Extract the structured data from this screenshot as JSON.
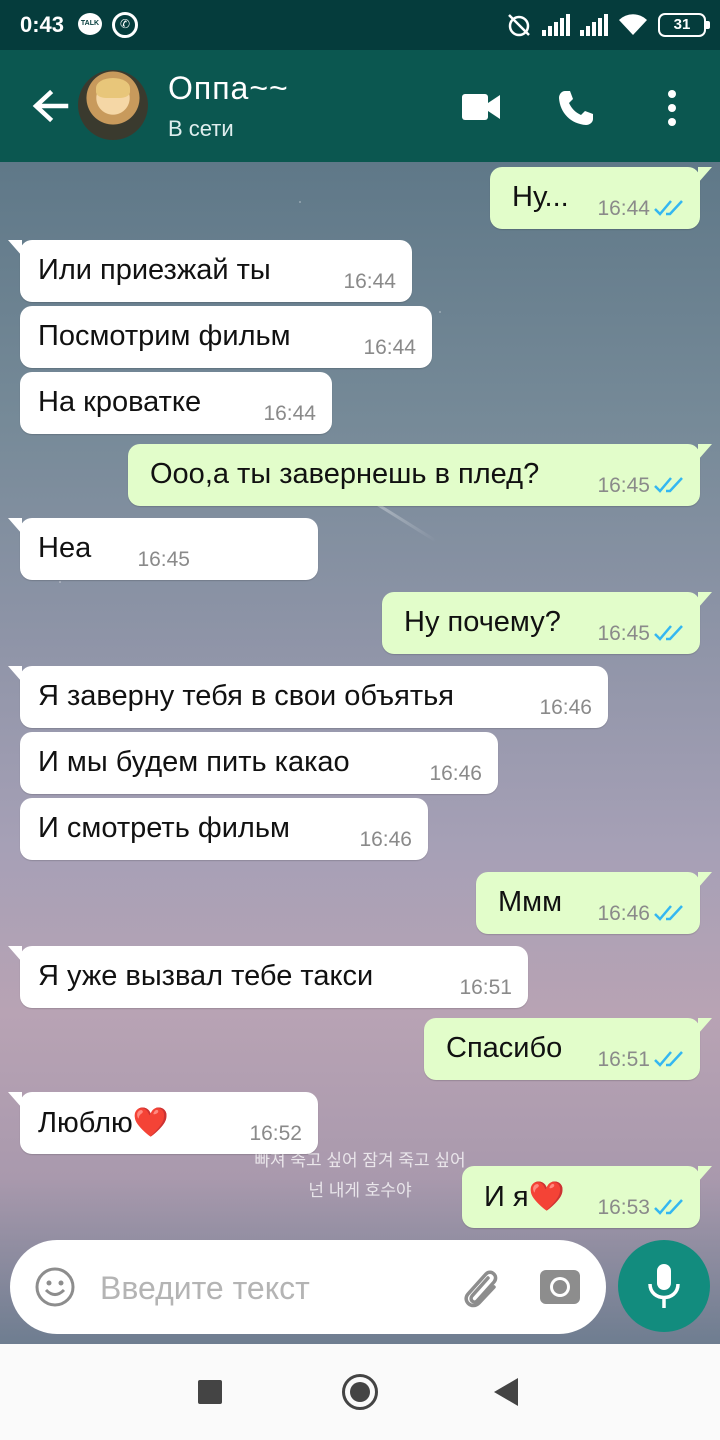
{
  "status_bar": {
    "time": "0:43",
    "talk_badge": "TALK",
    "battery": "31"
  },
  "header": {
    "contact_name": "Оппа~~",
    "contact_status": "В сети"
  },
  "messages": [
    {
      "dir": "out",
      "text": "Ну...",
      "time": "16:44"
    },
    {
      "dir": "in",
      "text": "Или приезжай ты",
      "time": "16:44"
    },
    {
      "dir": "in",
      "text": "Посмотрим фильм",
      "time": "16:44"
    },
    {
      "dir": "in",
      "text": "На кроватке",
      "time": "16:44"
    },
    {
      "dir": "out",
      "text": "Ооо,а ты завернешь в плед?",
      "time": "16:45"
    },
    {
      "dir": "in",
      "text": "Неа",
      "time": "16:45"
    },
    {
      "dir": "out",
      "text": "Ну почему?",
      "time": "16:45"
    },
    {
      "dir": "in",
      "text": "Я заверну тебя в свои объятья",
      "time": "16:46"
    },
    {
      "dir": "in",
      "text": "И мы будем пить какао",
      "time": "16:46"
    },
    {
      "dir": "in",
      "text": "И смотреть фильм",
      "time": "16:46"
    },
    {
      "dir": "out",
      "text": "Ммм",
      "time": "16:46"
    },
    {
      "dir": "in",
      "text": "Я уже вызвал тебе такси",
      "time": "16:51"
    },
    {
      "dir": "out",
      "text": "Спасибо",
      "time": "16:51"
    },
    {
      "dir": "in",
      "text": "Люблю❤️",
      "time": "16:52"
    },
    {
      "dir": "out",
      "text": "И я❤️",
      "time": "16:53"
    }
  ],
  "wallpaper_text": {
    "line1": "빠져 죽고 싶어 잠겨 죽고 싶어",
    "line2": "넌 내게 호수야"
  },
  "input": {
    "placeholder": "Введите текст"
  },
  "colors": {
    "header_bg": "#0b5750",
    "status_bar_bg": "#053c3c",
    "outgoing_bubble": "#e2fdca",
    "incoming_bubble": "#ffffff",
    "read_ticks": "#34b7f1",
    "mic_button": "#128c7e"
  },
  "icons": [
    "back-arrow-icon",
    "video-call-icon",
    "phone-icon",
    "more-vert-icon",
    "emoji-icon",
    "attach-icon",
    "camera-icon",
    "mic-icon",
    "double-check-icon"
  ]
}
